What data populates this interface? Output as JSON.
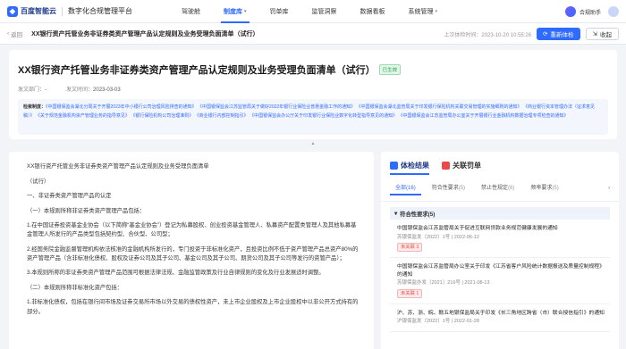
{
  "nav": {
    "logo_text": "百度智能云",
    "platform": "数字化合规管理平台",
    "menu": [
      {
        "label": "驾驶舱"
      },
      {
        "label": "制度库",
        "caret": "▾"
      },
      {
        "label": "罚单库"
      },
      {
        "label": "监管洞察"
      },
      {
        "label": "数据看板"
      },
      {
        "label": "系统管理",
        "caret": "▾"
      }
    ],
    "assistant": "合规助手"
  },
  "subheader": {
    "back": "返回",
    "title": "XX银行资产托管业务非证券类资产管理产品认定规则及业务受理负面清单（试行）",
    "last_check": "上次体检时间：2023-10-20 10:55:26",
    "recheck": "重新体检",
    "collapse": "收起"
  },
  "header": {
    "title": "XX银行资产托管业务非证券类资产管理产品认定规则及业务受理负面清单（试行）",
    "status": "已生效",
    "dept_label": "发文部门：",
    "dept_value": "-",
    "date_label": "发文时间：",
    "date_value": "2023-03-03",
    "refs_label": "检索制度：",
    "refs_text": "《中国银保监会湖北分局关于开展2023年中小银行公司治理风险排查的通知》 《中国银保监会江苏监管局关于做好2022年银行业保险业普惠金融工作的通知》 《中国银保监会湖北监管局关于印发银行保险机构关联交易管理的实施细则的通知》 《商业银行资本管理办法（征求意见稿）》 《关于规范金融机构资产管理业务的指导意见》 《银行保险机构公司治理准则》 《商业银行内部控制指引》 《中国银保监会办公厅关于印发银行业保险业数字化转型指导意见的通知》 《中国银保监会江苏监管局办公室关于开展银行业金融机构数据治理专项检查的通知》"
  },
  "document": {
    "paragraphs": [
      "XX银行资产托管业务非证券类资产管理产品认定规则及业务受理负面清单",
      "（试行）",
      "一、非证券类资产管理产品的认定",
      "（一）本规则所称非证券类资产管理产品包括：",
      "1.在中国证券投资基金业协会（以下简称“基金业协会”）登记为私募股权、创业投资基金管理人、私募资产配置类管理人及其他私募基金管理人所发行的产品类型包括契约型、合伙型、公司型；",
      "2.经国务院金融监督管理机构依法核准的金融机构所发行的，专门投资于非标准化资产，且投资比例不低于资产管理产品总资产80%的资产管理产品（含非标准化债权、股权及证券公司及其子公司、基金公司及其子公司、期货公司及其子公司等发行的资管产品）；",
      "3.本规则所称的非证券类资产管理产品范围可根据法律法规、金融监管政策及行业自律规则的变化及行业发展适时调整。",
      "（二）本规则所称非标准化资产包括：",
      "1.非标准化债权，包括在银行间市场及证券交易所市场以外交易的债权性资产，未上市企业股权及上市企业股权中以非公开方式持有的部分。"
    ]
  },
  "panel": {
    "tab_check": "体检结果",
    "tab_penalty": "关联罚单",
    "filters": [
      {
        "label": "全部",
        "count": "(16)"
      },
      {
        "label": "符合性要求",
        "count": "(5)"
      },
      {
        "label": "禁止性规定",
        "count": "(6)"
      },
      {
        "label": "频率要求",
        "count": "(5)"
      }
    ],
    "section": "符合性要求(5)",
    "items": [
      {
        "title": "中国银保监会江苏监管局关于促进互联网贷款业务规范健康发展的通知",
        "meta": "苏银保监发〔2022〕1号 | 2022-06-12",
        "tag": "未关联 3"
      },
      {
        "title": "中国银保监会江苏监管局办公室关于印发《江苏省客户风险统计数据报送及质量控制规程》的通知",
        "meta": "苏银保监办发〔2021〕216号 | 2021-08-13",
        "tag": "未关联 1"
      },
      {
        "title": "沪、苏、浙、皖、赣五地银保监局关于印发《长三角地区跨省（市）联合授信指引》的通知",
        "meta": "沪银保监发〔2022〕1号 | 2022-01-28",
        "tag": ""
      }
    ]
  }
}
